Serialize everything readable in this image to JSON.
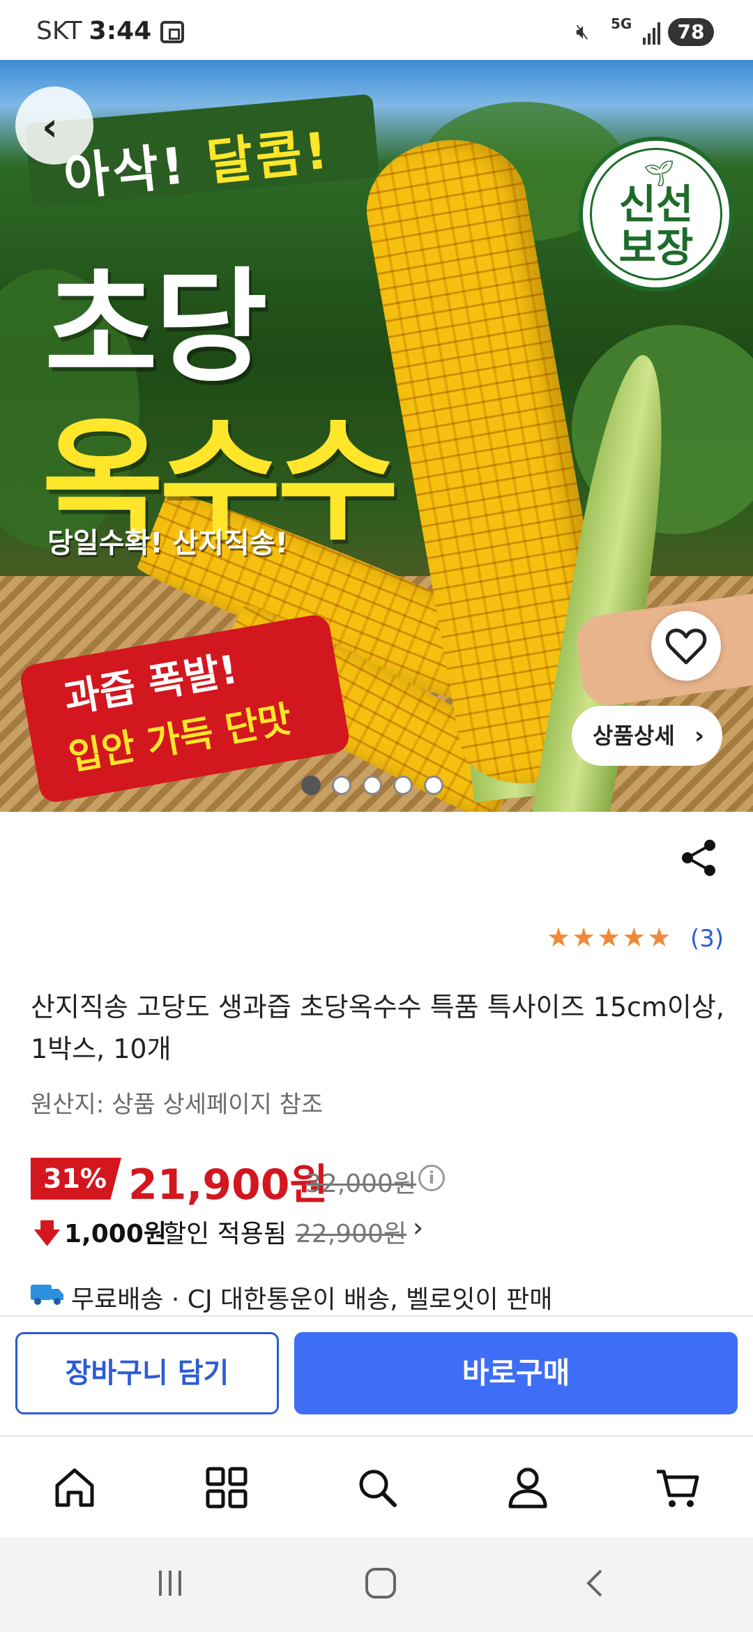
{
  "status_bar": {
    "carrier": "SKT",
    "time": "3:44",
    "network": "5G",
    "battery": "78",
    "icons": [
      "screenshot-icon",
      "mute-icon",
      "5g-icon",
      "signal-icon",
      "battery-icon"
    ]
  },
  "hero": {
    "tagline_part1": "아삭!",
    "tagline_part2": "달콤!",
    "title_line1": "초당",
    "title_line2": "옥수수",
    "subtag": "당일수확! 산지직송!",
    "red_line1": "과즙 폭발!",
    "red_line2": "입안 가득 단맛",
    "seal_line1": "신선",
    "seal_line2": "보장",
    "detail_button": "상품상세",
    "slide_count": 5,
    "active_slide": 1
  },
  "product": {
    "rating_stars": 5,
    "review_count": "(3)",
    "title": "산지직송 고당도 생과즙 초당옥수수 특품 특사이즈 15cm이상, 1박스, 10개",
    "origin": "원산지: 상품 상세페이지 참조",
    "discount_rate": "31%",
    "price": "21,900원",
    "original_price": "32,000원",
    "coupon_amount": "1,000원",
    "coupon_text": "할인 적용됨",
    "coupon_price": "22,900원",
    "shipping": "무료배송 · CJ 대한통운이 배송, 벨로잇이 판매"
  },
  "actions": {
    "cart": "장바구니 담기",
    "buy": "바로구매"
  },
  "bottom_nav": [
    "home-icon",
    "category-icon",
    "search-icon",
    "account-icon",
    "cart-icon"
  ],
  "colors": {
    "brand_blue": "#3d6ef5",
    "price_red": "#d3171f",
    "star_orange": "#f08a3a",
    "seal_green": "#1f6b2a"
  }
}
